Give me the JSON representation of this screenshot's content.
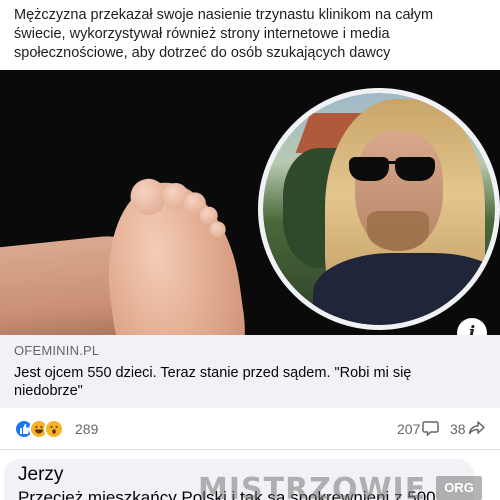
{
  "post": {
    "text": "Mężczyzna przekazał swoje nasienie trzynastu klinikom na całym świecie, wykorzystywał również strony internetowe i media społecznościowe, aby dotrzeć do osób szukających dawcy"
  },
  "link_preview": {
    "domain": "OFEMININ.PL",
    "title": "Jest ojcem 550 dzieci. Teraz stanie przed sądem. \"Robi mi się niedobrze\"",
    "info_icon": "i"
  },
  "engagement": {
    "reaction_icons": [
      "like-icon",
      "haha-icon",
      "wow-icon"
    ],
    "reaction_count": "289",
    "comment_count": "207",
    "share_count": "38"
  },
  "comment": {
    "author": "Jerzy",
    "text": "Przecież mieszkańcy Polski i tak są spokrewnieni z 500"
  },
  "watermark": {
    "text": "MISTRZOWIE",
    "suffix": "ORG"
  },
  "colors": {
    "accent": "#1877f2",
    "card_bg": "#f0f2f5",
    "muted_text": "#65676b"
  }
}
